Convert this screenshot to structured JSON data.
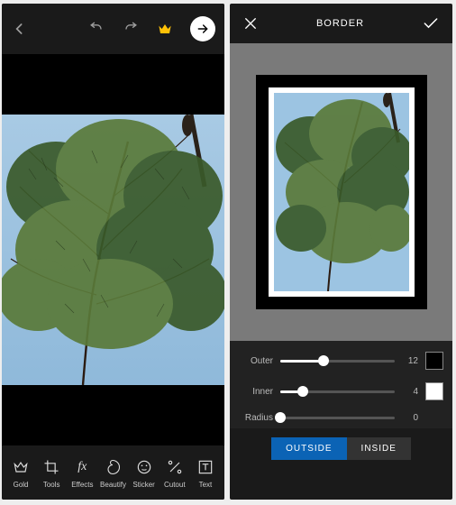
{
  "left": {
    "toolbar": {
      "gold": {
        "label": "Gold"
      },
      "tools": {
        "label": "Tools"
      },
      "effects": {
        "label": "Effects"
      },
      "beautify": {
        "label": "Beautify"
      },
      "sticker": {
        "label": "Sticker"
      },
      "cutout": {
        "label": "Cutout"
      },
      "text": {
        "label": "Text"
      }
    }
  },
  "right": {
    "title": "BORDER",
    "sliders": {
      "outer": {
        "label": "Outer",
        "value": "12",
        "pct": 38,
        "swatch": "#000000"
      },
      "inner": {
        "label": "Inner",
        "value": "4",
        "pct": 20,
        "swatch": "#ffffff"
      },
      "radius": {
        "label": "Radius",
        "value": "0",
        "pct": 0
      }
    },
    "tabs": {
      "outside": "OUTSIDE",
      "inside": "INSIDE"
    }
  }
}
